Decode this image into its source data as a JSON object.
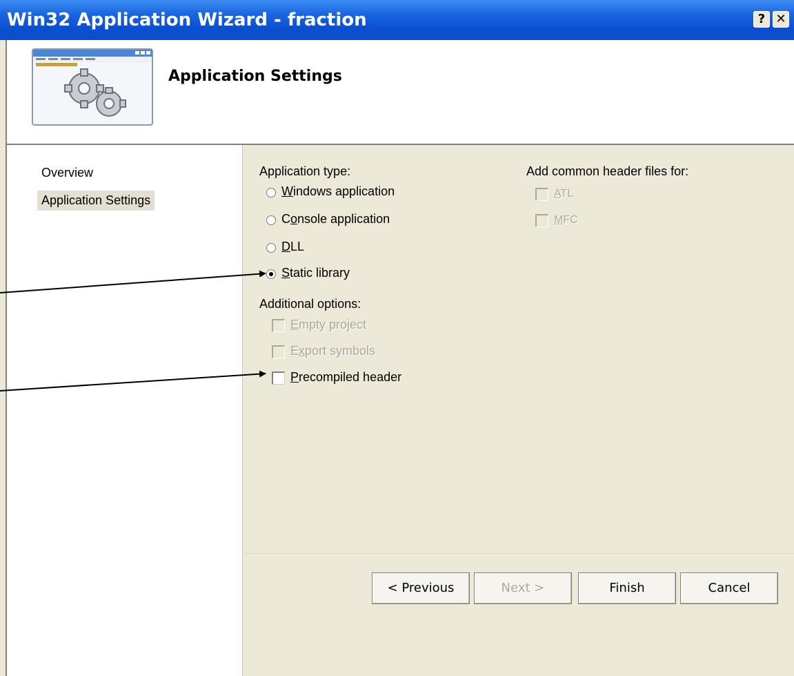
{
  "window": {
    "title": "Win32 Application Wizard - fraction",
    "help_glyph": "?",
    "close_glyph": "✕"
  },
  "header": {
    "title": "Application Settings"
  },
  "nav": {
    "items": [
      {
        "label": "Overview"
      },
      {
        "label": "Application Settings",
        "selected": true
      }
    ]
  },
  "app_type": {
    "label": "Application type:",
    "options": [
      {
        "pre": "",
        "key": "W",
        "post": "indows application",
        "checked": false
      },
      {
        "pre": "C",
        "key": "o",
        "post": "nsole application",
        "checked": false
      },
      {
        "pre": "",
        "key": "D",
        "post": "LL",
        "checked": false
      },
      {
        "pre": "",
        "key": "S",
        "post": "tatic library",
        "checked": true
      }
    ]
  },
  "additional": {
    "label": "Additional options:",
    "options": [
      {
        "pre": "",
        "key": "E",
        "post": "mpty project",
        "checked": false,
        "disabled": true
      },
      {
        "pre": "E",
        "key": "x",
        "post": "port symbols",
        "checked": false,
        "disabled": true
      },
      {
        "pre": "",
        "key": "P",
        "post": "recompiled header",
        "checked": false,
        "disabled": false
      }
    ]
  },
  "common_headers": {
    "label": "Add common header files for:",
    "options": [
      {
        "pre": "",
        "key": "A",
        "post": "TL",
        "checked": false,
        "disabled": true
      },
      {
        "pre": "",
        "key": "M",
        "post": "FC",
        "checked": false,
        "disabled": true
      }
    ]
  },
  "buttons": {
    "previous": "< Previous",
    "next": "Next >",
    "finish": "Finish",
    "cancel": "Cancel"
  },
  "colors": {
    "titlebar": "#0b4fd2",
    "dialog_bg": "#ece9d8",
    "disabled_text": "#aca899"
  }
}
